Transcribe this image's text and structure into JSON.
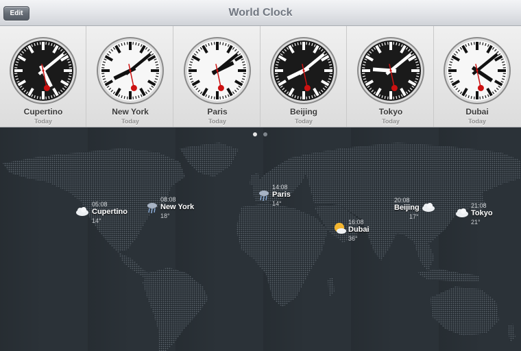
{
  "navbar": {
    "edit_label": "Edit",
    "title": "World Clock"
  },
  "clocks": [
    {
      "city": "Cupertino",
      "day": "Today",
      "theme": "dark",
      "hour": 5,
      "minute": 8,
      "second": 28
    },
    {
      "city": "New York",
      "day": "Today",
      "theme": "light",
      "hour": 8,
      "minute": 8,
      "second": 28
    },
    {
      "city": "Paris",
      "day": "Today",
      "theme": "light",
      "hour": 14,
      "minute": 8,
      "second": 28
    },
    {
      "city": "Beijing",
      "day": "Today",
      "theme": "dark",
      "hour": 20,
      "minute": 8,
      "second": 28
    },
    {
      "city": "Tokyo",
      "day": "Today",
      "theme": "dark",
      "hour": 21,
      "minute": 8,
      "second": 28
    },
    {
      "city": "Dubai",
      "day": "Today",
      "theme": "light",
      "hour": 16,
      "minute": 8,
      "second": 28
    }
  ],
  "pager": {
    "pages": 2,
    "current": 1
  },
  "map_markers": [
    {
      "city": "Cupertino",
      "time": "05:08",
      "temp": "14°",
      "weather": "cloudy-night-icon"
    },
    {
      "city": "New York",
      "time": "08:08",
      "temp": "18°",
      "weather": "rain-icon"
    },
    {
      "city": "Paris",
      "time": "14:08",
      "temp": "14°",
      "weather": "rain-icon"
    },
    {
      "city": "Dubai",
      "time": "16:08",
      "temp": "36°",
      "weather": "sun-cloud-icon"
    },
    {
      "city": "Beijing",
      "time": "20:08",
      "temp": "17°",
      "weather": "cloudy-night-icon"
    },
    {
      "city": "Tokyo",
      "time": "21:08",
      "temp": "21°",
      "weather": "cloudy-night-icon"
    }
  ],
  "colors": {
    "clock_second_hand": "#cc1111",
    "map_background": "#2b3238",
    "land_dots": "#5d666e"
  }
}
